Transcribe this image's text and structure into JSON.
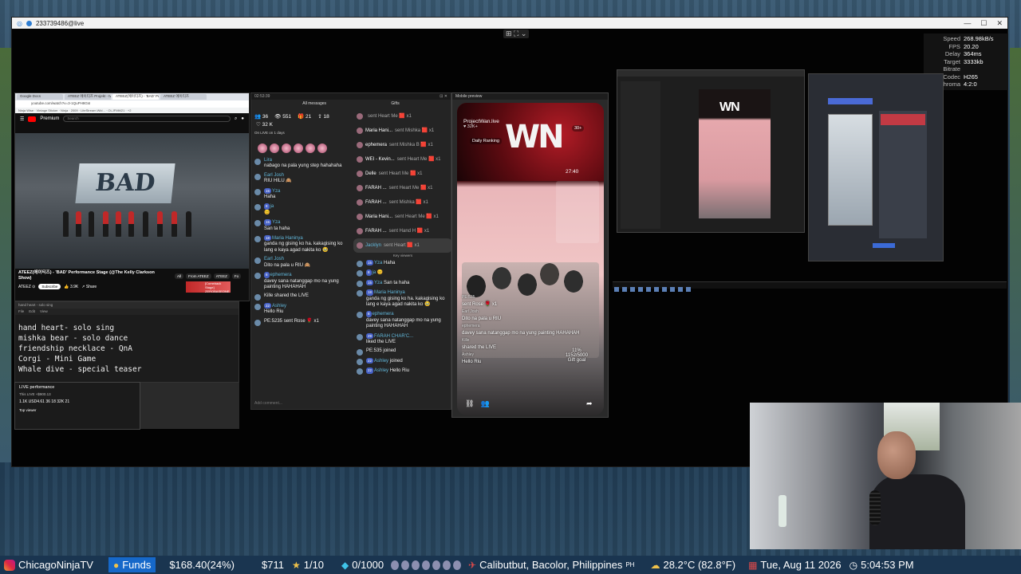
{
  "window": {
    "title": "233739486@live",
    "controls": [
      "—",
      "☐",
      "✕"
    ],
    "center_control": "⊞ ⛶ ⌄"
  },
  "stats": [
    {
      "label": "Speed",
      "value": "268.98kB/s"
    },
    {
      "label": "FPS",
      "value": "20.20"
    },
    {
      "label": "Delay",
      "value": "364ms"
    },
    {
      "label": "Target Bitrate",
      "value": "3333kb"
    },
    {
      "label": "Codec",
      "value": "H265"
    },
    {
      "label": "Chroma",
      "value": "4:2:0"
    }
  ],
  "browser": {
    "tabs": [
      "Google Docs",
      "ATEEZ 에이티즈 Projekt - tvdo",
      "ATEEZ(에이티즈) - 'BAD' Perfor...",
      "ATEEZ 에이티즈"
    ],
    "url": "youtube.com/watch?v=3-1QuPH8GsI",
    "bookmarks": "Ninja Wise · Vintage Sticker · Ninja · 2009 · LiteStream Wid... · OLJFMM21 · +2",
    "yt_brand": "Premium",
    "yt_search": "Search",
    "video_sign": "BAD",
    "video_title": "ATEEZ(에이티즈) - 'BAD' Performance Stage (@The Kelly Clarkson Show)",
    "channel": "ATEEZ ⊙",
    "subscribe": "Subscribe",
    "likes": "3.9K",
    "share": "Share",
    "chips": [
      "All",
      "From ATEEZ",
      "ATEEZ",
      "Fo"
    ],
    "thumb_caption": "[Comeback Stage] ZEROBASEONE"
  },
  "notepad": {
    "title": "hand heart - solo sing",
    "menu": [
      "File",
      "Edit",
      "View"
    ],
    "lines": [
      "hand heart- solo sing",
      "mishka bear - solo dance",
      "friendship necklace - QnA",
      "Corgi - Mini Game",
      "Whale dive - special teaser"
    ]
  },
  "live_perf": {
    "title": "LIVE performance",
    "sub": "This LIVE +$900.13",
    "stats": "1.1K   USD4.61   36   18   32K   21",
    "top_viewer": "Top viewer"
  },
  "chat": {
    "header_left": "02:53:39",
    "header_right": "⊡ ✕",
    "all_messages": "All messages",
    "gifts_label": "Gifts",
    "counters": [
      "36",
      "551",
      "21",
      "18"
    ],
    "likes": "32 K",
    "ontime": "On LIVE on 1 days",
    "left": [
      {
        "user": "Lira",
        "text": "nabago na pala yung step hahahaha"
      },
      {
        "user": "Earl Josh",
        "text": "RIU HILU 🙈"
      },
      {
        "user": "Yza",
        "text": "Haha"
      },
      {
        "user": "ja",
        "text": "😊"
      },
      {
        "user": "Yza",
        "text": "San ta haha"
      },
      {
        "user": "Maria Haninya",
        "text": "ganda ng gising ko ha. kakagising ko lang e kaya agad nakita ko 🥹"
      },
      {
        "user": "Earl Josh",
        "text": "Dito na pala u RIU 🙈"
      },
      {
        "user": "ephemera",
        "text": "davey sana natanggap mo na yung painting HAHAHAH"
      },
      {
        "user": "Kille",
        "text": "shared the LIVE"
      },
      {
        "user": "Ashley",
        "text": "Hello Riu"
      },
      {
        "user": "PE:5235",
        "text": "sent Rose 🌹 x1"
      }
    ],
    "right": [
      {
        "user": "",
        "text": "sent Heart Me 🟥 x1"
      },
      {
        "user": "Maria Hani...",
        "text": "sent Mishka 🟥 x1"
      },
      {
        "user": "ephemera",
        "text": "sent Mishka B 🟥 x1"
      },
      {
        "user": "WEI - Kevin...",
        "text": "sent Heart Me 🟥 x1"
      },
      {
        "user": "Delle",
        "text": "sent Heart Me 🟥 x1"
      },
      {
        "user": "FARAH ...",
        "text": "sent Heart Me 🟥 x1"
      },
      {
        "user": "FARAH ...",
        "text": "sent Mishka 🟥 x1"
      },
      {
        "user": "Maria Hani...",
        "text": "sent Heart Me 🟥 x1"
      },
      {
        "user": "FARAH ...",
        "text": "sent Hand H 🟥 x1"
      },
      {
        "user": "Jacklyn",
        "text": "sent Heart 🟥 x1"
      }
    ],
    "key_viewers": "Key viewers",
    "right_lower": [
      {
        "user": "Yza",
        "text": "Haha"
      },
      {
        "user": "ja",
        "text": "😊"
      },
      {
        "user": "Yza",
        "text": "San ta haha"
      },
      {
        "user": "Maria Haninya",
        "text": "ganda ng gising ko ha. kakagising ko lang e kaya agad nakita ko 🥹"
      },
      {
        "user": "ephemera",
        "text": "davey sana natanggap mo na yung painting HAHAHAH"
      },
      {
        "user": "FARAH CHAR'C...",
        "text": "liked the LIVE"
      },
      {
        "user": "PE:535",
        "text": "joined"
      },
      {
        "user": "Ashley",
        "text": "joined"
      },
      {
        "user": "Ashley",
        "text": "Hello Riu"
      }
    ],
    "footer": "Add comment..."
  },
  "phone": {
    "window_title": "Mobile preview",
    "account": "ProjectWan.live",
    "account_sub": "♥ 32K+",
    "rank": "Daily Ranking",
    "viewers": "30+",
    "logo": "WN",
    "timer": "27:40",
    "messages": [
      {
        "user": "PE:535",
        "text": "sent Rose 🌹 x1"
      },
      {
        "user": "Earl Josh",
        "text": "Dito na pala u RIU"
      },
      {
        "user": "ephemera",
        "text": "davey sana natanggap mo na yung painting HAHAHAH"
      },
      {
        "user": "Kille",
        "text": "shared the LIVE"
      },
      {
        "user": "Ashley",
        "text": "Hello Riu"
      }
    ],
    "gift_pct": "11%",
    "gift_count": "1152/5000",
    "gift_goal": "Gift goal"
  },
  "editor1": {
    "logo": "WN"
  },
  "ticker": {
    "channel": "ChicagoNinjaTV",
    "funds_label": "Funds",
    "funds_value": "$168.40(24%)",
    "cash": "$711",
    "stars": "1/10",
    "gems": "0/1000",
    "location": "Calibutbut, Bacolor, Philippines",
    "country": "PH",
    "weather": "28.2°C (82.8°F)",
    "date": "Tue, Aug 11 2026",
    "time": "5:04:53 PM"
  }
}
